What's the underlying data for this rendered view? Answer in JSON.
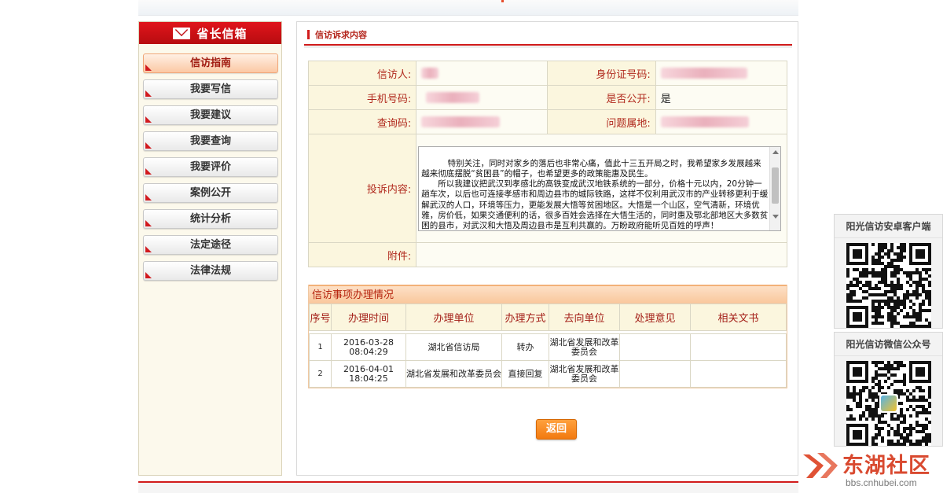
{
  "sidebar": {
    "title": "省长信箱",
    "items": [
      {
        "label": "信访指南",
        "active": true
      },
      {
        "label": "我要写信"
      },
      {
        "label": "我要建议"
      },
      {
        "label": "我要查询"
      },
      {
        "label": "我要评价"
      },
      {
        "label": "案例公开"
      },
      {
        "label": "统计分析"
      },
      {
        "label": "法定途径"
      },
      {
        "label": "法律法规"
      }
    ]
  },
  "main": {
    "section_title": "信访诉求内容",
    "info": {
      "petitioner_label": "信访人:",
      "id_label": "身份证号码:",
      "phone_label": "手机号码:",
      "public_label": "是否公开:",
      "public_value": "是",
      "query_code_label": "查询码:",
      "location_label": "问题属地:",
      "complaint_label": "投诉内容:",
      "complaint_text": "特别关注，同时对家乡的落后也非常心痛，值此十三五开局之时，我希望家乡发展越来越来彻底摆脱“贫困县”的帽子，也希望更多的政策能惠及民生。\n　　所以我建议把武汉到孝感北的高铁变成武汉地铁系统的一部分，价格十元以内，20分钟一趟车次，以后也可连接孝感市和周边县市的城际铁路，这样不仅利用武汉市的产业转移更利于缓解武汉的人口，环境等压力，更能发展大悟等贫困地区。大悟是一个山区，空气清新，环境优雅，房价低，如果交通便利的话，很多百姓会选择在大悟生活的，同时惠及鄂北部地区大多数贫困的县市，对武汉和大悟及周边县市是互利共赢的。万盼政府能听见百姓的呼声！",
      "attachment_label": "附件:"
    },
    "processing": {
      "title": "信访事项办理情况",
      "headers": [
        "序号",
        "办理时间",
        "办理单位",
        "办理方式",
        "去向单位",
        "处理意见",
        "相关文书"
      ],
      "rows": [
        {
          "no": "1",
          "time_date": "2016-03-28",
          "time_clock": "08:04:29",
          "unit": "湖北省信访局",
          "method": "转办",
          "to_unit": "湖北省发展和改革委员会",
          "opinion": "",
          "docs": ""
        },
        {
          "no": "2",
          "time_date": "2016-04-01",
          "time_clock": "18:04:25",
          "unit": "湖北省发展和改革委员会",
          "method": "直接回复",
          "to_unit": "湖北省发展和改革委员会",
          "opinion": "",
          "docs": ""
        }
      ]
    },
    "back_label": "返回"
  },
  "right": {
    "android_title": "阳光信访安卓客户端",
    "wechat_title": "阳光信访微信公众号"
  },
  "watermark": {
    "text": "东湖社区",
    "url": "bbs.cnhubei.com"
  },
  "colors": {
    "brand_red": "#d11c1c",
    "label_red": "#b12a1e",
    "button_orange": "#f27a10",
    "watermark_red": "#d94a30"
  }
}
